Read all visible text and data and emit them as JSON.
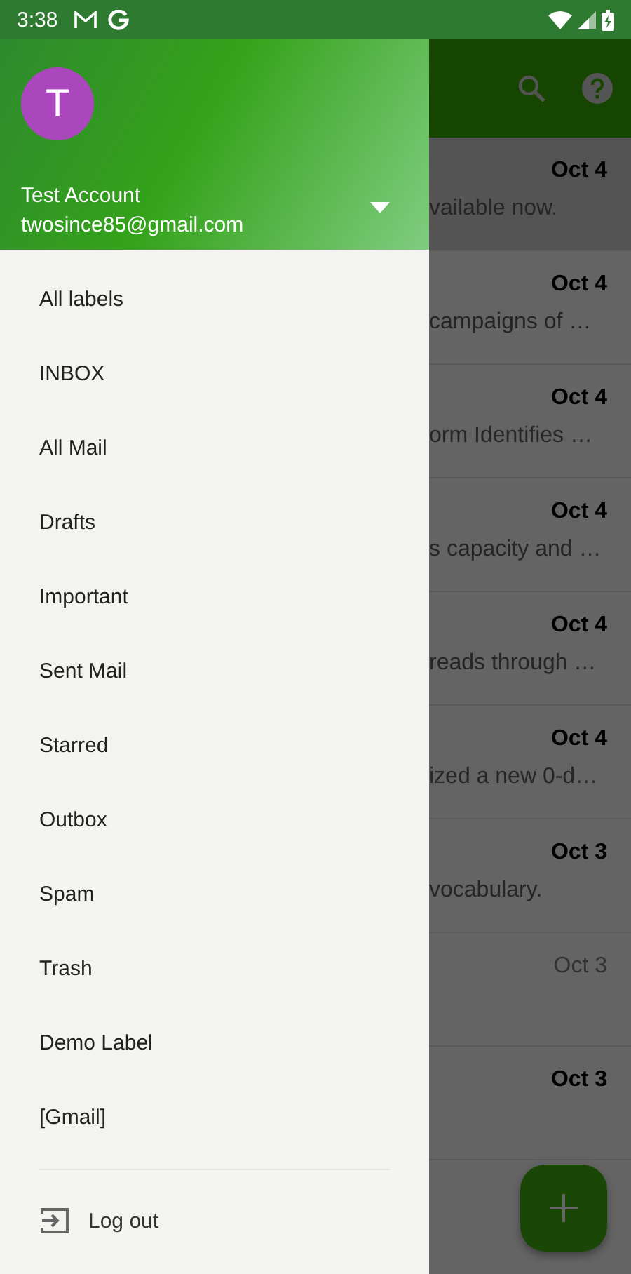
{
  "status_bar": {
    "time": "3:38"
  },
  "account": {
    "initial": "T",
    "name": "Test Account",
    "email": "twosince85@gmail.com"
  },
  "labels": [
    {
      "label": "All labels"
    },
    {
      "label": "INBOX"
    },
    {
      "label": "All Mail"
    },
    {
      "label": "Drafts"
    },
    {
      "label": "Important"
    },
    {
      "label": "Sent Mail"
    },
    {
      "label": "Starred"
    },
    {
      "label": "Outbox"
    },
    {
      "label": "Spam"
    },
    {
      "label": "Trash"
    },
    {
      "label": "Demo Label"
    },
    {
      "label": "[Gmail]"
    }
  ],
  "logout": {
    "label": "Log out"
  },
  "emails": [
    {
      "date": "Oct 4",
      "snippet": "vailable now.",
      "unread": true,
      "selected": true
    },
    {
      "date": "Oct 4",
      "snippet": "campaigns of …",
      "unread": true,
      "selected": false
    },
    {
      "date": "Oct 4",
      "snippet": "orm Identifies …",
      "unread": true,
      "selected": false
    },
    {
      "date": "Oct 4",
      "snippet": "s capacity and …",
      "unread": true,
      "selected": false
    },
    {
      "date": "Oct 4",
      "snippet": "reads through …",
      "unread": true,
      "selected": false
    },
    {
      "date": "Oct 4",
      "snippet": "ized a new 0-d…",
      "unread": true,
      "selected": false
    },
    {
      "date": "Oct 3",
      "snippet": "vocabulary.",
      "unread": true,
      "selected": false
    },
    {
      "date": "Oct 3",
      "unread": false,
      "selected": false
    },
    {
      "date": "Oct 3",
      "unread": true,
      "selected": false
    }
  ]
}
